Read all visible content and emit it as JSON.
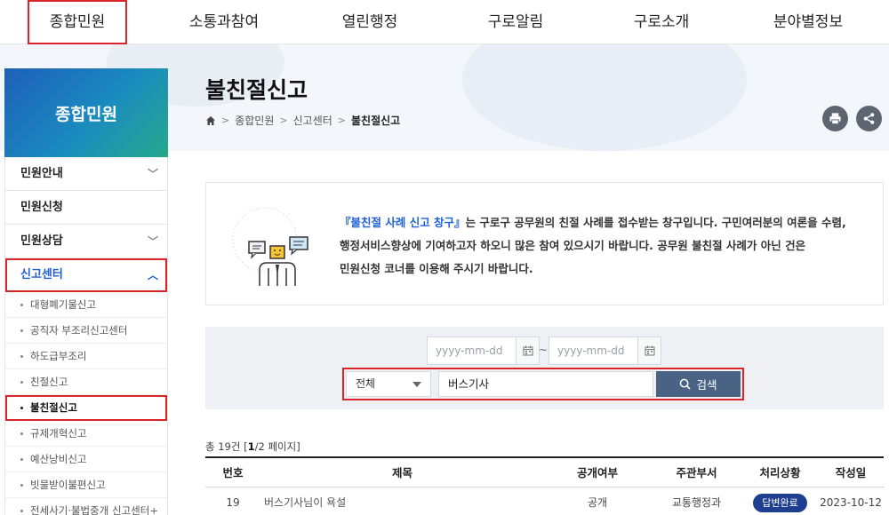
{
  "topnav": {
    "items": [
      {
        "label": "종합민원",
        "highlighted": true
      },
      {
        "label": "소통과참여",
        "highlighted": false
      },
      {
        "label": "열린행정",
        "highlighted": false
      },
      {
        "label": "구로알림",
        "highlighted": false
      },
      {
        "label": "구로소개",
        "highlighted": false
      },
      {
        "label": "분야별정보",
        "highlighted": false
      }
    ]
  },
  "sidebar": {
    "title": "종합민원",
    "menu": [
      {
        "label": "민원안내",
        "icon": "chevron-down-icon"
      },
      {
        "label": "민원신청"
      },
      {
        "label": "민원상담",
        "icon": "chevron-down-icon"
      },
      {
        "label": "신고센터",
        "icon": "chevron-up-icon",
        "active": true
      }
    ],
    "submenu": [
      {
        "label": "대형폐기물신고"
      },
      {
        "label": "공직자 부조리신고센터"
      },
      {
        "label": "하도급부조리"
      },
      {
        "label": "친절신고"
      },
      {
        "label": "불친절신고",
        "current": true
      },
      {
        "label": "규제개혁신고"
      },
      {
        "label": "예산낭비신고"
      },
      {
        "label": "빗물받이불편신고"
      },
      {
        "label": "전세사기·불법중개 신고센터",
        "expandable": "+"
      }
    ]
  },
  "header": {
    "title": "불친절신고",
    "breadcrumb": [
      "종합민원",
      "신고센터",
      "불친절신고"
    ],
    "actions": {
      "print": "print-icon",
      "share": "share-icon"
    }
  },
  "info": {
    "emphasis": "『불친절 사례 신고 창구』",
    "line1": "는 구로구 공무원의 친절 사례를 접수받는 창구입니다. 구민여러분의 여론을 수렴,",
    "line2": "행정서비스향상에 기여하고자 하오니 많은 참여 있으시기 바랍니다. 공무원 불친절 사례가 아닌 건은",
    "line3": "민원신청 코너를 이용해 주시기 바랍니다."
  },
  "search": {
    "date_from_placeholder": "yyyy-mm-dd",
    "date_to_placeholder": "yyyy-mm-dd",
    "tilde": "~",
    "select_value": "전체",
    "keyword": "버스기사",
    "button_label": "검색"
  },
  "list": {
    "count_prefix": "총 19건 [",
    "page_current": "1",
    "page_total": "/2 페이지",
    "count_suffix": "]",
    "headers": [
      "번호",
      "제목",
      "공개여부",
      "주관부서",
      "처리상황",
      "작성일"
    ],
    "rows": [
      {
        "no": "19",
        "title": "버스기사님이 욕설",
        "open": "공개",
        "dept": "교통행정과",
        "status": "답변완료",
        "date": "2023-10-12"
      }
    ]
  },
  "colors": {
    "accent": "#1f5fd6",
    "highlight": "#d9242a",
    "search_button": "#4a6384",
    "badge": "#1e3f8f"
  }
}
